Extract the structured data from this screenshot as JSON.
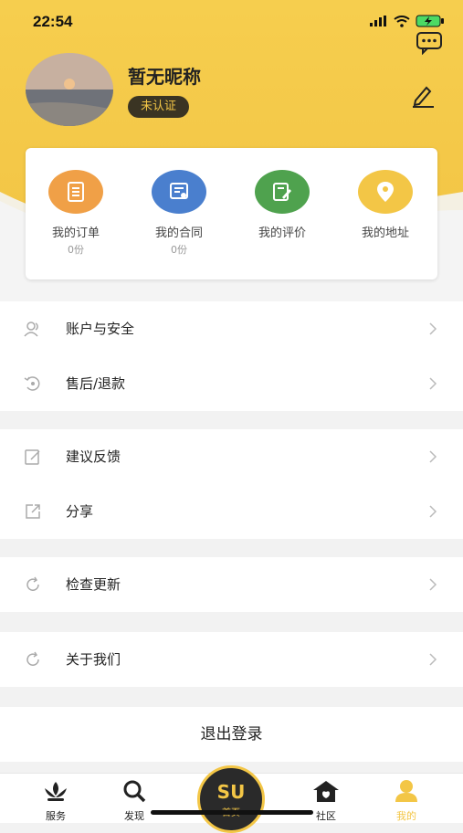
{
  "status_bar": {
    "time": "22:54"
  },
  "profile": {
    "nickname": "暂无昵称",
    "verification_badge": "未认证"
  },
  "quick_actions": [
    {
      "label": "我的订单",
      "count": "0份",
      "icon": "order-list-icon",
      "color": "#f0a047"
    },
    {
      "label": "我的合同",
      "count": "0份",
      "icon": "contract-icon",
      "color": "#4a7fce"
    },
    {
      "label": "我的评价",
      "count": "",
      "icon": "review-edit-icon",
      "color": "#4fa24e"
    },
    {
      "label": "我的地址",
      "count": "",
      "icon": "location-pin-icon",
      "color": "#f3c646"
    }
  ],
  "menu": {
    "account_security": "账户与安全",
    "after_sales": "售后/退款",
    "feedback": "建议反馈",
    "share": "分享",
    "check_update": "检查更新",
    "about_us": "关于我们"
  },
  "logout_label": "退出登录",
  "tab_bar": {
    "services": "服务",
    "discover": "发现",
    "home": "首页",
    "home_logo": "SU",
    "community": "社区",
    "mine": "我的"
  },
  "colors": {
    "accent": "#f3c646",
    "dark": "#2a2a2a"
  }
}
